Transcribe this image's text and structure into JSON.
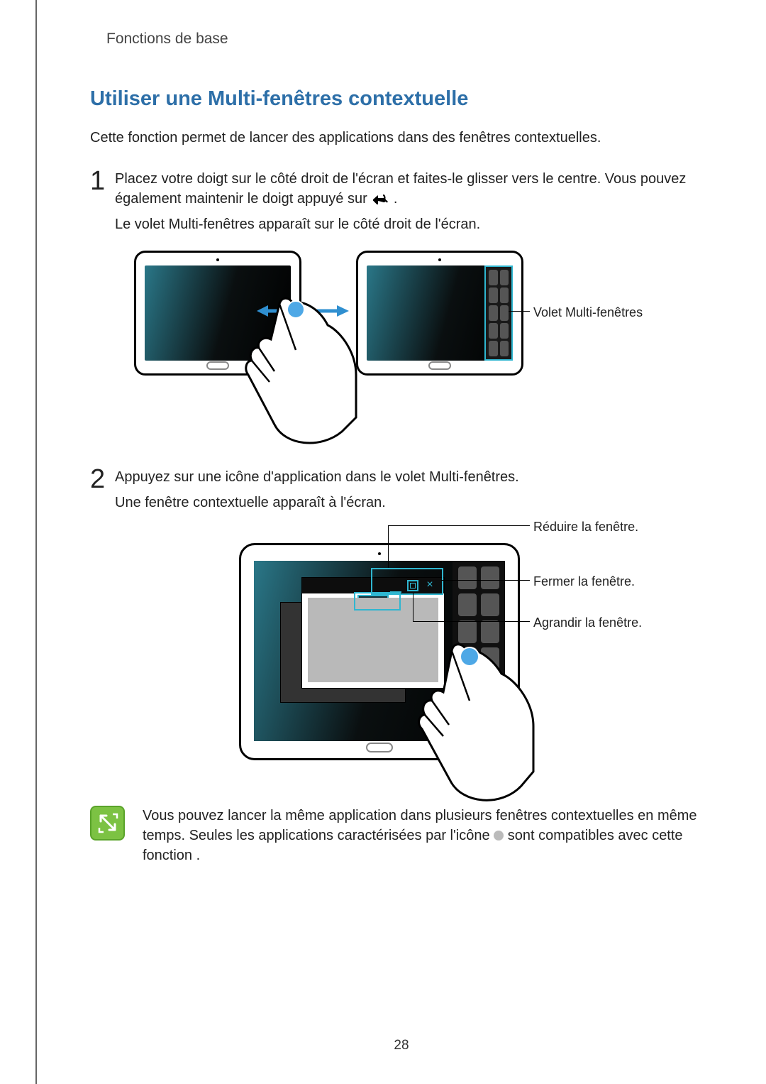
{
  "header": {
    "section": "Fonctions de base"
  },
  "title": "Utiliser une Multi-fenêtres contextuelle",
  "intro": "Cette fonction permet de lancer des applications dans des fenêtres contextuelles.",
  "steps": [
    {
      "num": "1",
      "p1a": "Placez votre doigt sur le côté droit de l'écran et faites-le glisser vers le centre. Vous pouvez également maintenir le doigt appuyé sur ",
      "p1b": ".",
      "p2": "Le volet Multi-fenêtres apparaît sur le côté droit de l'écran."
    },
    {
      "num": "2",
      "p1": "Appuyez sur une icône d'application dans le volet Multi-fenêtres.",
      "p2": "Une fenêtre contextuelle apparaît à l'écran."
    }
  ],
  "callouts": {
    "fig1_panel": "Volet Multi-fenêtres",
    "fig2_minimize": "Réduire la fenêtre.",
    "fig2_close": "Fermer la fenêtre.",
    "fig2_maximize": "Agrandir la fenêtre."
  },
  "note": {
    "p1a": "Vous pouvez lancer la même application dans plusieurs fenêtres contextuelles en même temps. Seules les applications caractérisées par l'icône ",
    "p1b": " sont compatibles avec cette fonction ."
  },
  "page_number": "28"
}
